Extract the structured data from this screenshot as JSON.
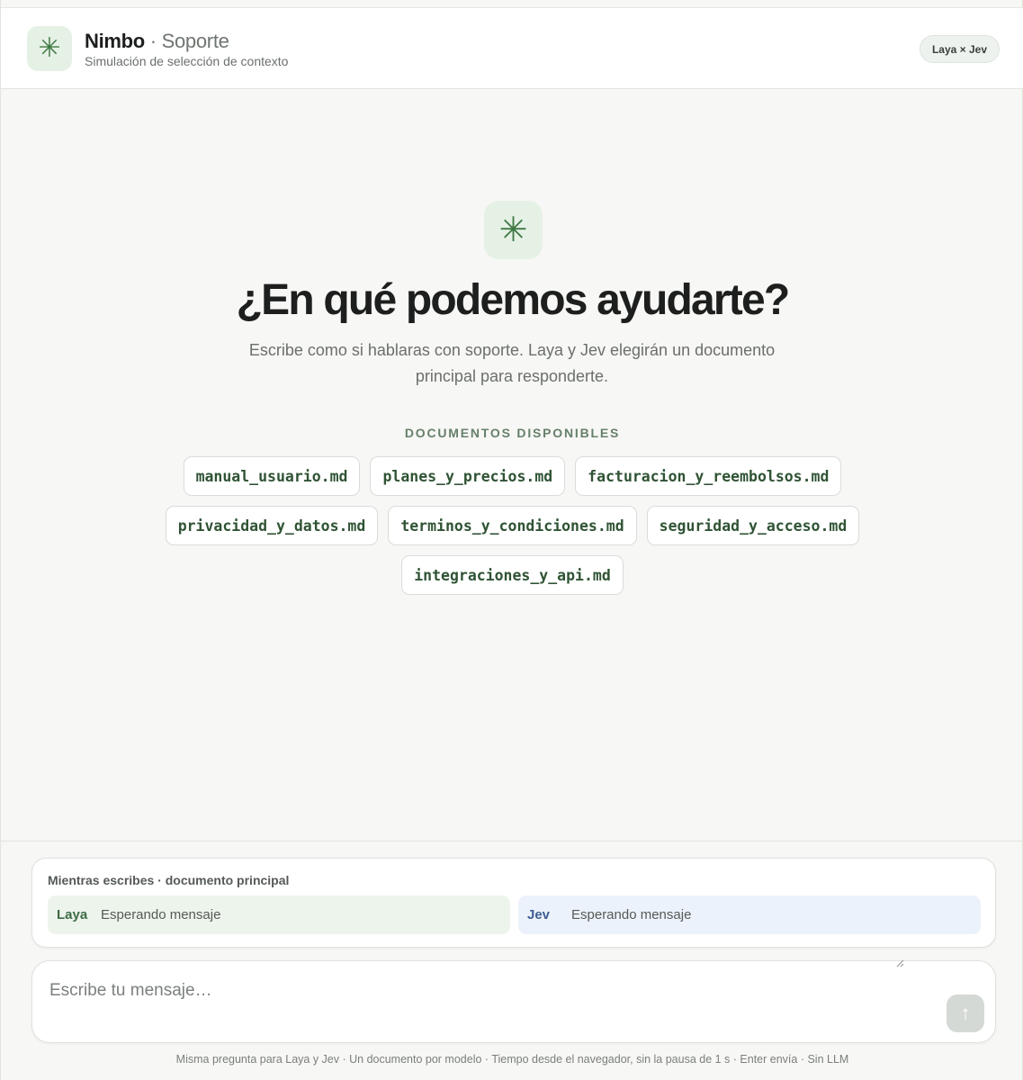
{
  "header": {
    "logo_icon": "asterisk-icon",
    "brand_name": "Nimbo",
    "brand_separator": " · ",
    "brand_section": "Soporte",
    "subtitle": "Simulación de selección de contexto",
    "pair_badge": "Laya × Jev"
  },
  "hero": {
    "icon": "asterisk-icon",
    "title": "¿En qué podemos ayudarte?",
    "subtitle": "Escribe como si hablaras con soporte. Laya y Jev elegirán un documento principal para responderte."
  },
  "documents": {
    "heading": "DOCUMENTOS DISPONIBLES",
    "items": [
      "manual_usuario.md",
      "planes_y_precios.md",
      "facturacion_y_reembolsos.md",
      "privacidad_y_datos.md",
      "terminos_y_condiciones.md",
      "seguridad_y_acceso.md",
      "integraciones_y_api.md"
    ]
  },
  "typing_panel": {
    "title": "Mientras escribes · documento principal",
    "laya": {
      "name": "Laya",
      "status": "Esperando mensaje"
    },
    "jev": {
      "name": "Jev",
      "status": "Esperando mensaje"
    }
  },
  "composer": {
    "placeholder": "Escribe tu mensaje…",
    "value": "",
    "send_icon": "arrow-up-icon"
  },
  "footer": {
    "note": "Misma pregunta para Laya y Jev · Un documento por modelo · Tiempo desde el navegador, sin la pausa de 1 s · Enter envía · Sin LLM"
  },
  "colors": {
    "accent_green": "#3f7a45",
    "accent_green_bg": "#e6f1e6",
    "laya_bg": "#edf4ec",
    "jev_bg": "#ecf2fb",
    "jev_blue": "#3e5f93"
  }
}
